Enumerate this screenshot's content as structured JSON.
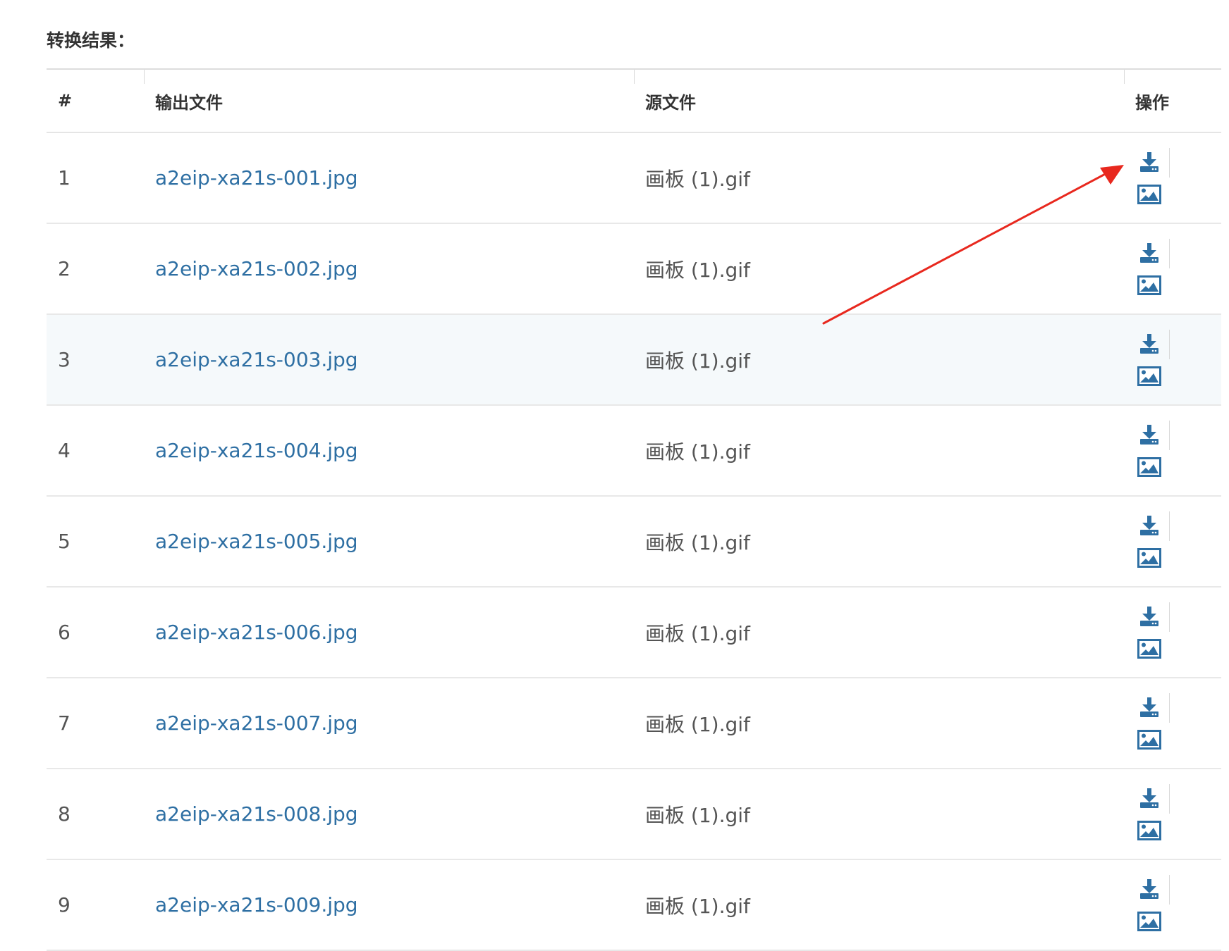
{
  "section_title": "转换结果：",
  "table": {
    "headers": {
      "index": "#",
      "output_file": "输出文件",
      "source_file": "源文件",
      "actions": "操作"
    },
    "rows": [
      {
        "index": "1",
        "output_file": "a2eip-xa21s-001.jpg",
        "source_file": "画板 (1).gif"
      },
      {
        "index": "2",
        "output_file": "a2eip-xa21s-002.jpg",
        "source_file": "画板 (1).gif"
      },
      {
        "index": "3",
        "output_file": "a2eip-xa21s-003.jpg",
        "source_file": "画板 (1).gif"
      },
      {
        "index": "4",
        "output_file": "a2eip-xa21s-004.jpg",
        "source_file": "画板 (1).gif"
      },
      {
        "index": "5",
        "output_file": "a2eip-xa21s-005.jpg",
        "source_file": "画板 (1).gif"
      },
      {
        "index": "6",
        "output_file": "a2eip-xa21s-006.jpg",
        "source_file": "画板 (1).gif"
      },
      {
        "index": "7",
        "output_file": "a2eip-xa21s-007.jpg",
        "source_file": "画板 (1).gif"
      },
      {
        "index": "8",
        "output_file": "a2eip-xa21s-008.jpg",
        "source_file": "画板 (1).gif"
      },
      {
        "index": "9",
        "output_file": "a2eip-xa21s-009.jpg",
        "source_file": "画板 (1).gif"
      }
    ],
    "highlighted_row_index": 3
  },
  "icons": {
    "download": "download-icon",
    "preview": "image-preview-icon"
  },
  "colors": {
    "link": "#2e6fa3",
    "icon": "#2e6fa3",
    "annotation_arrow": "#e8281e",
    "highlight_row": "#f5f9fb"
  }
}
